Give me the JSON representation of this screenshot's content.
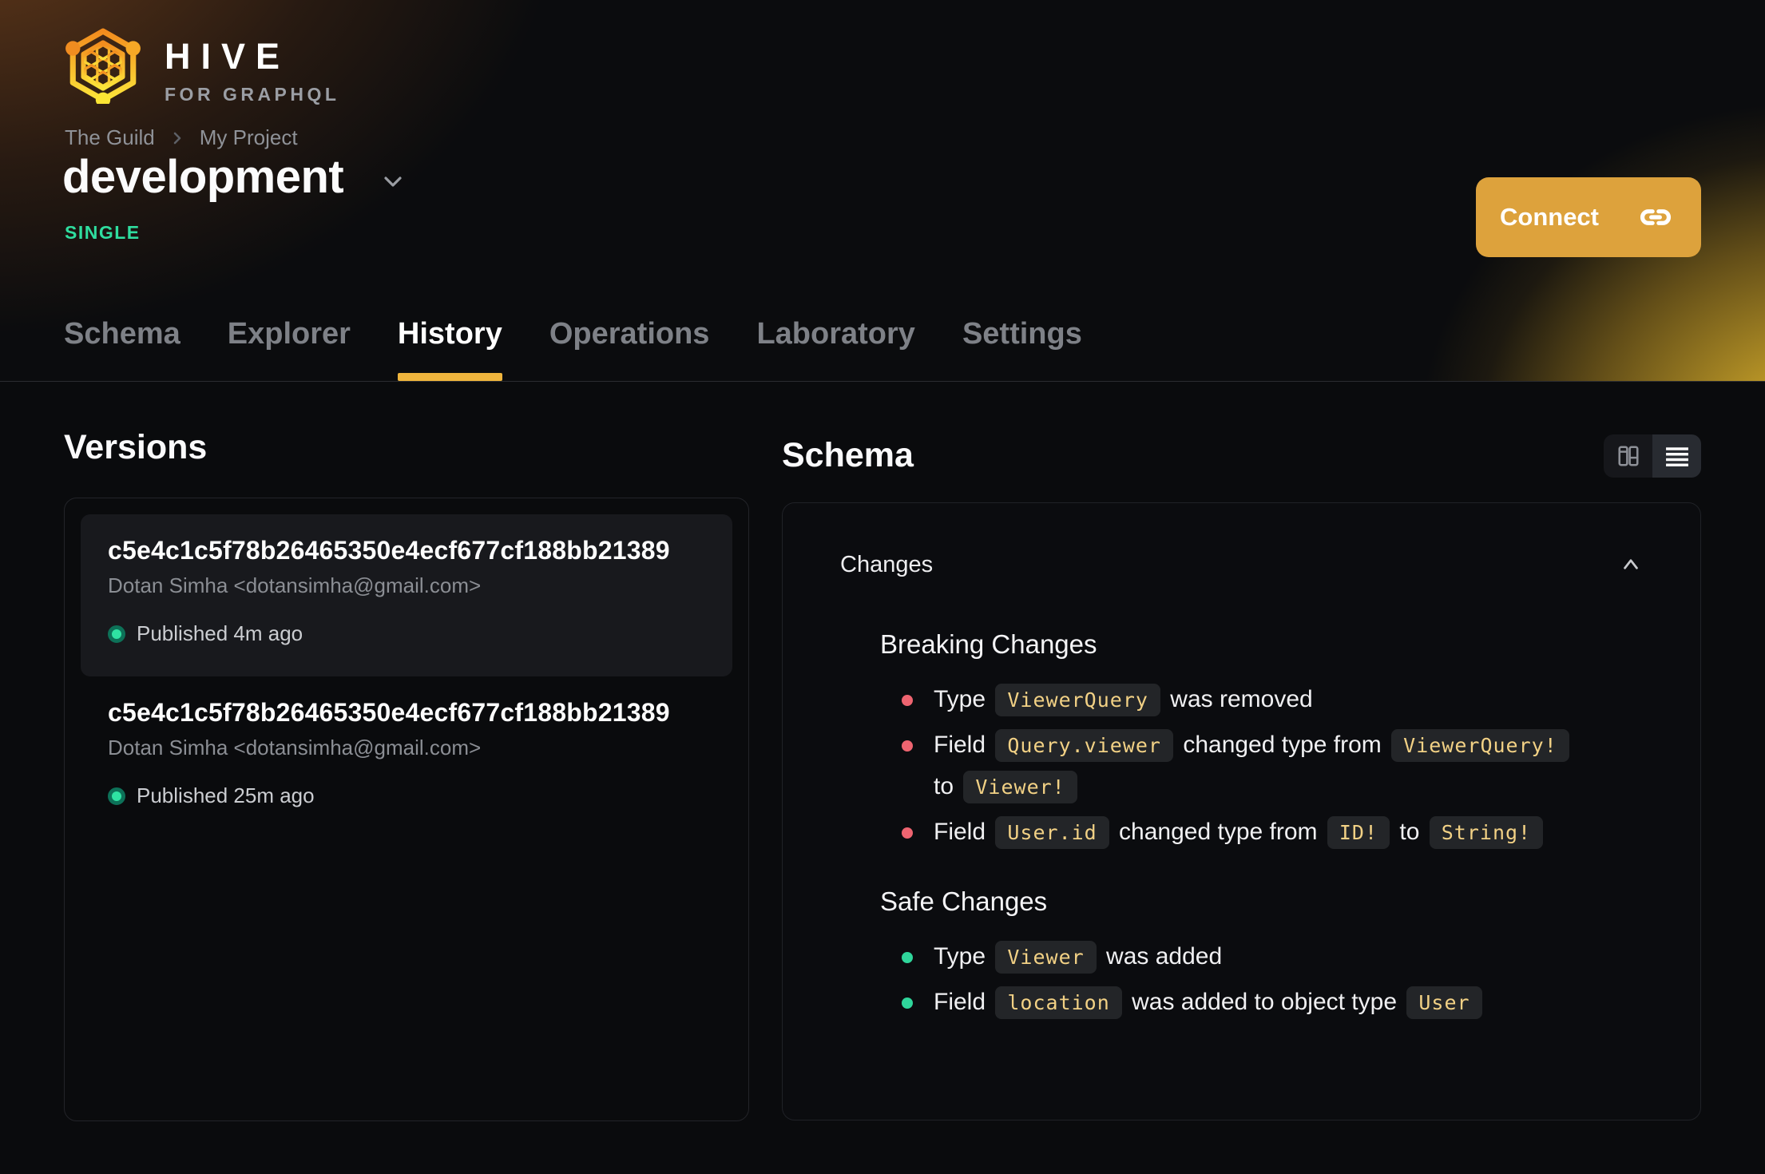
{
  "brand": {
    "name": "HIVE",
    "tagline": "FOR GRAPHQL"
  },
  "breadcrumb": {
    "items": [
      "The Guild",
      "My Project"
    ]
  },
  "target": {
    "name": "development",
    "badge": "SINGLE"
  },
  "connect": {
    "label": "Connect"
  },
  "tabs": {
    "items": [
      {
        "label": "Schema",
        "active": false
      },
      {
        "label": "Explorer",
        "active": false
      },
      {
        "label": "History",
        "active": true
      },
      {
        "label": "Operations",
        "active": false
      },
      {
        "label": "Laboratory",
        "active": false
      },
      {
        "label": "Settings",
        "active": false
      }
    ]
  },
  "versions": {
    "title": "Versions",
    "items": [
      {
        "hash": "c5e4c1c5f78b26465350e4ecf677cf188bb21389",
        "author": "Dotan Simha <dotansimha@gmail.com>",
        "status": "Published 4m ago",
        "highlighted": true
      },
      {
        "hash": "c5e4c1c5f78b26465350e4ecf677cf188bb21389",
        "author": "Dotan Simha <dotansimha@gmail.com>",
        "status": "Published 25m ago",
        "highlighted": false
      }
    ]
  },
  "schema": {
    "title": "Schema",
    "view_toggle": {
      "options": [
        "columns-view",
        "list-view"
      ],
      "active": "list-view"
    },
    "changes": {
      "title": "Changes",
      "sections": [
        {
          "title": "Breaking Changes",
          "severity": "breaking",
          "items": [
            [
              {
                "t": "text",
                "v": "Type "
              },
              {
                "t": "code",
                "v": "ViewerQuery"
              },
              {
                "t": "text",
                "v": " was removed"
              }
            ],
            [
              {
                "t": "text",
                "v": "Field "
              },
              {
                "t": "code",
                "v": "Query.viewer"
              },
              {
                "t": "text",
                "v": " changed type from "
              },
              {
                "t": "code",
                "v": "ViewerQuery!"
              },
              {
                "t": "text",
                "v": " to "
              },
              {
                "t": "code",
                "v": "Viewer!"
              }
            ],
            [
              {
                "t": "text",
                "v": "Field "
              },
              {
                "t": "code",
                "v": "User.id"
              },
              {
                "t": "text",
                "v": " changed type from "
              },
              {
                "t": "code",
                "v": "ID!"
              },
              {
                "t": "text",
                "v": " to "
              },
              {
                "t": "code",
                "v": "String!"
              }
            ]
          ]
        },
        {
          "title": "Safe Changes",
          "severity": "safe",
          "items": [
            [
              {
                "t": "text",
                "v": "Type "
              },
              {
                "t": "code",
                "v": "Viewer"
              },
              {
                "t": "text",
                "v": " was added"
              }
            ],
            [
              {
                "t": "text",
                "v": "Field "
              },
              {
                "t": "code",
                "v": "location"
              },
              {
                "t": "text",
                "v": " was added to object type "
              },
              {
                "t": "code",
                "v": "User"
              }
            ]
          ]
        }
      ]
    }
  },
  "colors": {
    "accent": "#efb53d",
    "connect_bg": "#dda23c",
    "badge_green": "#2fdd9f",
    "bullet_breaking": "#ee6470",
    "bullet_safe": "#2fd69b",
    "code_text": "#f2d185"
  }
}
